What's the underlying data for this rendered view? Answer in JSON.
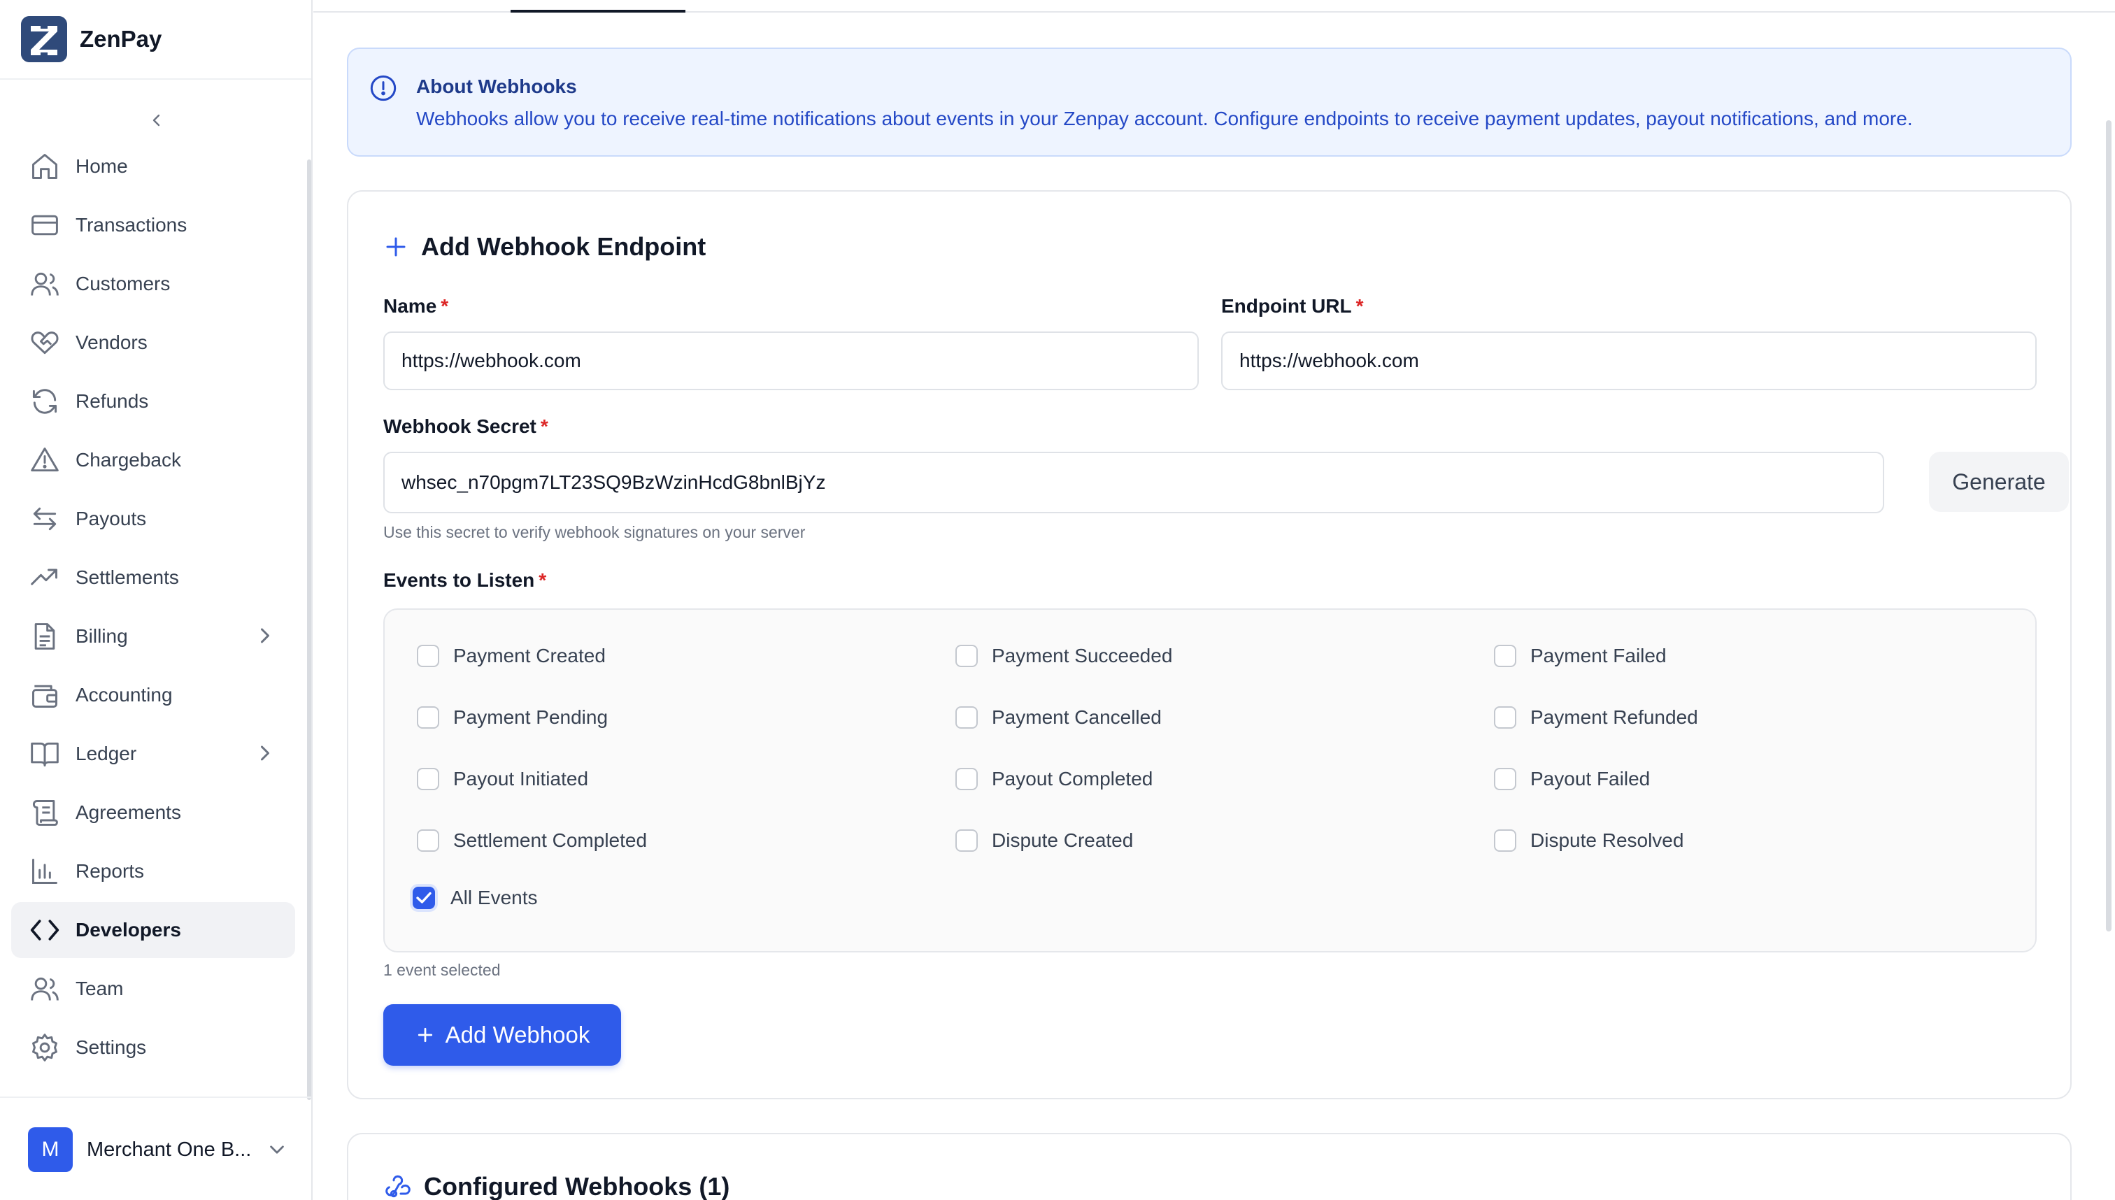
{
  "brand": {
    "name": "ZenPay"
  },
  "sidebar": {
    "items": [
      {
        "label": "Home",
        "icon": "home-icon"
      },
      {
        "label": "Transactions",
        "icon": "credit-card-icon"
      },
      {
        "label": "Customers",
        "icon": "users-icon"
      },
      {
        "label": "Vendors",
        "icon": "handshake-icon"
      },
      {
        "label": "Refunds",
        "icon": "refresh-icon"
      },
      {
        "label": "Chargeback",
        "icon": "warning-icon"
      },
      {
        "label": "Payouts",
        "icon": "arrows-icon"
      },
      {
        "label": "Settlements",
        "icon": "trending-up-icon"
      },
      {
        "label": "Billing",
        "icon": "document-icon"
      },
      {
        "label": "Accounting",
        "icon": "wallet-icon"
      },
      {
        "label": "Ledger",
        "icon": "book-icon"
      },
      {
        "label": "Agreements",
        "icon": "scroll-icon"
      },
      {
        "label": "Reports",
        "icon": "bar-chart-icon"
      },
      {
        "label": "Developers",
        "icon": "code-icon"
      },
      {
        "label": "Team",
        "icon": "users-icon"
      },
      {
        "label": "Settings",
        "icon": "gear-icon"
      }
    ],
    "active": "Developers",
    "merchant": {
      "initial": "M",
      "name": "Merchant One B..."
    }
  },
  "info": {
    "title": "About Webhooks",
    "text": "Webhooks allow you to receive real-time notifications about events in your Zenpay account. Configure endpoints to receive payment updates, payout notifications, and more."
  },
  "form": {
    "title": "Add Webhook Endpoint",
    "name_label": "Name",
    "name_value": "https://webhook.com",
    "url_label": "Endpoint URL",
    "url_value": "https://webhook.com",
    "secret_label": "Webhook Secret",
    "secret_value": "whsec_n70pgm7LT23SQ9BzWzinHcdG8bnlBjYz",
    "generate_label": "Generate",
    "secret_hint": "Use this secret to verify webhook signatures on your server",
    "events_label": "Events to Listen",
    "required_mark": "*",
    "events": [
      {
        "label": "Payment Created",
        "checked": false
      },
      {
        "label": "Payment Succeeded",
        "checked": false
      },
      {
        "label": "Payment Failed",
        "checked": false
      },
      {
        "label": "Payment Pending",
        "checked": false
      },
      {
        "label": "Payment Cancelled",
        "checked": false
      },
      {
        "label": "Payment Refunded",
        "checked": false
      },
      {
        "label": "Payout Initiated",
        "checked": false
      },
      {
        "label": "Payout Completed",
        "checked": false
      },
      {
        "label": "Payout Failed",
        "checked": false
      },
      {
        "label": "Settlement Completed",
        "checked": false
      },
      {
        "label": "Dispute Created",
        "checked": false
      },
      {
        "label": "Dispute Resolved",
        "checked": false
      },
      {
        "label": "All Events",
        "checked": true
      }
    ],
    "selected_count": "1 event selected",
    "add_label": "Add Webhook"
  },
  "configured": {
    "title": "Configured Webhooks (1)"
  },
  "colors": {
    "accent": "#2f5bea",
    "info_bg": "#eef4ff",
    "required": "#dc2626"
  }
}
